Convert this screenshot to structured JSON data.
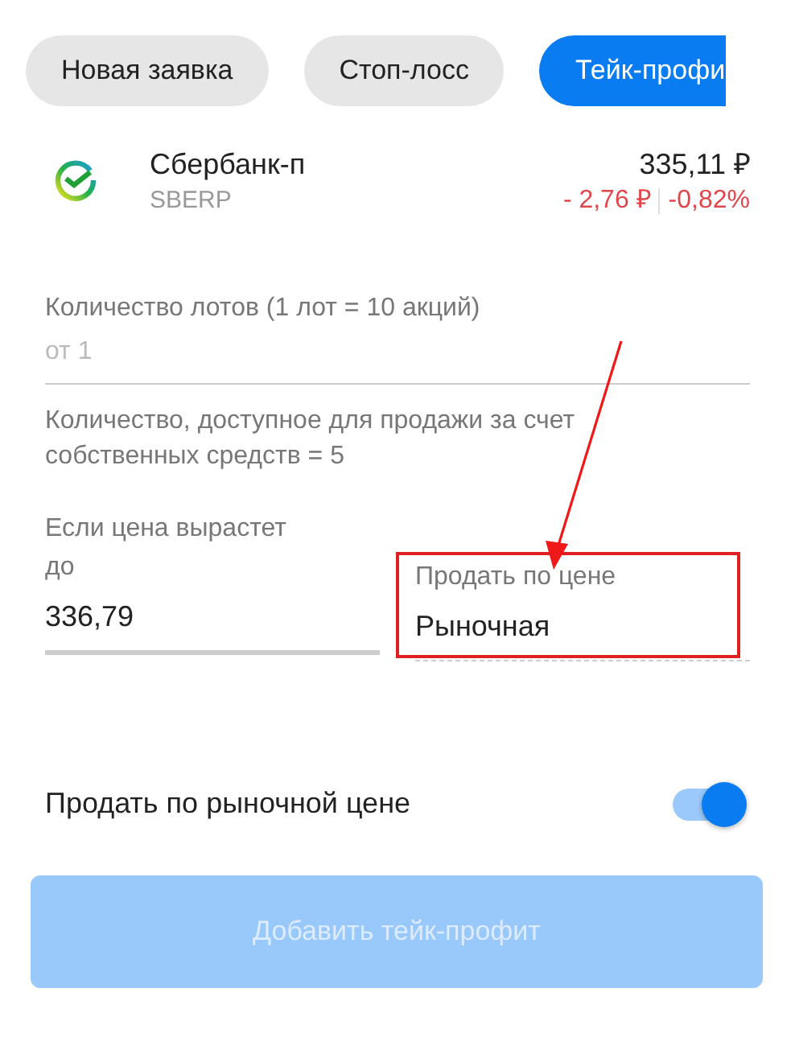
{
  "tabs": [
    {
      "label": "Новая заявка",
      "selected": false
    },
    {
      "label": "Стоп-лосс",
      "selected": false
    },
    {
      "label": "Тейк-профи",
      "selected": true
    }
  ],
  "instrument": {
    "name": "Сбербанк-п",
    "ticker": "SBERP",
    "price": "335,11 ₽",
    "change": "- 2,76 ₽",
    "change_percent": "-0,82%"
  },
  "lots_field": {
    "label": "Количество лотов (1 лот = 10 акций)",
    "placeholder": "от 1"
  },
  "available_note": "Количество, доступное для продажи за счет собственных средств = 5",
  "trigger_field": {
    "label": "Если цена вырастет до",
    "value": "336,79"
  },
  "sell_price_field": {
    "label": "Продать по цене",
    "value": "Рыночная",
    "disabled": true,
    "highlighted": true
  },
  "market_toggle": {
    "label": "Продать по рыночной цене",
    "on": true
  },
  "submit_button": {
    "label": "Добавить тейк-профит",
    "disabled": true
  }
}
